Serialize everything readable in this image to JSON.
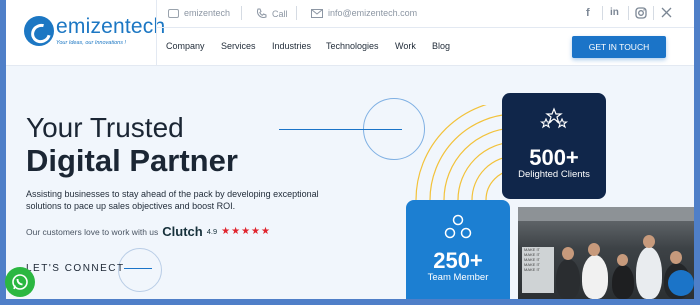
{
  "brand": {
    "name": "emizentech",
    "tagline": "Your Ideas, our Innovations !",
    "accent_color": "#1b74c8",
    "dark_color": "#10264a"
  },
  "topbar": {
    "brand_label": "emizentech",
    "call_label": "Call",
    "email": "info@emizentech.com",
    "socials": [
      "facebook-icon",
      "linkedin-icon",
      "instagram-icon",
      "x-icon"
    ]
  },
  "nav": {
    "items": [
      "Company",
      "Services",
      "Industries",
      "Technologies",
      "Work",
      "Blog"
    ],
    "cta_label": "GET IN TOUCH"
  },
  "hero": {
    "title_line1": "Your Trusted",
    "title_line2": "Digital Partner",
    "description": "Assisting businesses to stay ahead of the pack by developing exceptional solutions to pace up sales objectives and boost ROI.",
    "clutch_text": "Our customers love to work with us",
    "clutch_brand": "Clutch",
    "clutch_rating": "4.9",
    "stars": "★★★★★",
    "lets_connect": "LET'S CONNECT"
  },
  "stats": [
    {
      "icon": "stars-icon",
      "value": "500+",
      "label": "Delighted Clients"
    },
    {
      "icon": "team-icon",
      "value": "250+",
      "label": "Team Member"
    }
  ],
  "photo": {
    "board_text": [
      "MAKE IT",
      "MAKE IT",
      "MAKE IT",
      "MAKE IT",
      "MAKE IT"
    ]
  }
}
